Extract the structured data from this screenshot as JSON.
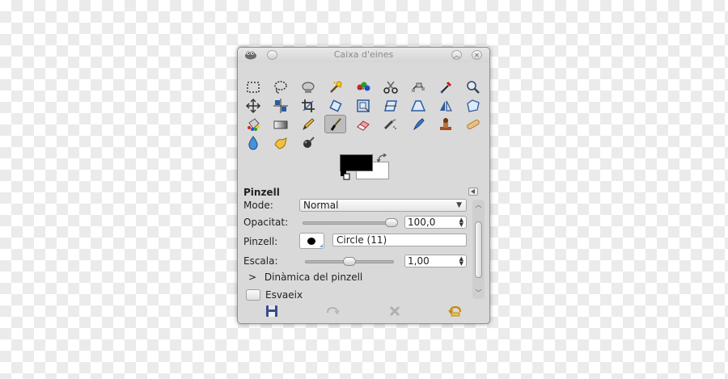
{
  "window": {
    "title": "Caixa d'eines",
    "app_icon": "gimp-wilber-icon",
    "buttons": [
      {
        "name": "minimize-button",
        "icon": "chevron-up-icon"
      },
      {
        "name": "close-button",
        "icon": "close-icon"
      }
    ]
  },
  "toolbox": {
    "tools": [
      {
        "name": "rect-select-tool",
        "icon": "rect-select-icon"
      },
      {
        "name": "free-select-tool",
        "icon": "lasso-icon"
      },
      {
        "name": "foreground-select-tool",
        "icon": "foreground-select-icon"
      },
      {
        "name": "fuzzy-select-tool",
        "icon": "magic-wand-icon"
      },
      {
        "name": "select-by-color-tool",
        "icon": "color-select-icon"
      },
      {
        "name": "scissors-select-tool",
        "icon": "scissors-icon"
      },
      {
        "name": "paths-tool",
        "icon": "paths-icon"
      },
      {
        "name": "color-picker-tool",
        "icon": "eyedropper-icon"
      },
      {
        "name": "zoom-tool",
        "icon": "magnifier-icon"
      },
      {
        "name": "measure-tool",
        "icon": "measure-icon"
      },
      {
        "name": "move-tool",
        "icon": "move-icon"
      },
      {
        "name": "align-tool",
        "icon": "align-icon"
      },
      {
        "name": "crop-tool",
        "icon": "crop-icon"
      },
      {
        "name": "rotate-tool",
        "icon": "rotate-icon"
      },
      {
        "name": "scale-tool",
        "icon": "scale-icon"
      },
      {
        "name": "shear-tool",
        "icon": "shear-icon"
      },
      {
        "name": "perspective-tool",
        "icon": "perspective-icon"
      },
      {
        "name": "flip-tool",
        "icon": "flip-icon"
      },
      {
        "name": "cage-transform-tool",
        "icon": "cage-icon"
      },
      {
        "name": "text-tool",
        "icon": "text-icon"
      },
      {
        "name": "bucket-fill-tool",
        "icon": "bucket-icon"
      },
      {
        "name": "blend-tool",
        "icon": "gradient-icon"
      },
      {
        "name": "pencil-tool",
        "icon": "pencil-icon"
      },
      {
        "name": "paintbrush-tool",
        "icon": "paintbrush-icon",
        "active": true
      },
      {
        "name": "eraser-tool",
        "icon": "eraser-icon"
      },
      {
        "name": "airbrush-tool",
        "icon": "airbrush-icon"
      },
      {
        "name": "ink-tool",
        "icon": "ink-pen-icon"
      },
      {
        "name": "clone-tool",
        "icon": "clone-stamp-icon"
      },
      {
        "name": "heal-tool",
        "icon": "bandage-icon"
      },
      {
        "name": "perspective-clone-tool",
        "icon": "perspective-clone-icon"
      },
      {
        "name": "blur-sharpen-tool",
        "icon": "water-drop-icon"
      },
      {
        "name": "smudge-tool",
        "icon": "smudge-hand-icon"
      },
      {
        "name": "dodge-burn-tool",
        "icon": "dodge-burn-icon"
      }
    ],
    "colors": {
      "foreground": "#000000",
      "background": "#ffffff"
    }
  },
  "tool_options": {
    "title": "Pinzell",
    "mode": {
      "label": "Mode:",
      "value": "Normal"
    },
    "opacity": {
      "label": "Opacitat:",
      "value": "100,0",
      "fraction": 1.0
    },
    "brush": {
      "label": "Pinzell:",
      "value": "Circle (11)"
    },
    "scale": {
      "label": "Escala:",
      "value": "1,00",
      "fraction": 0.5
    },
    "dynamics": {
      "label": "Dinàmica del pinzell",
      "arrow": ">"
    },
    "fade": {
      "label": "Esvaeix"
    }
  },
  "bottom_buttons": [
    {
      "name": "save-options-button",
      "icon": "floppy-icon"
    },
    {
      "name": "restore-options-button",
      "icon": "restore-icon"
    },
    {
      "name": "delete-options-button",
      "icon": "delete-icon"
    },
    {
      "name": "reset-options-button",
      "icon": "reset-icon"
    }
  ]
}
